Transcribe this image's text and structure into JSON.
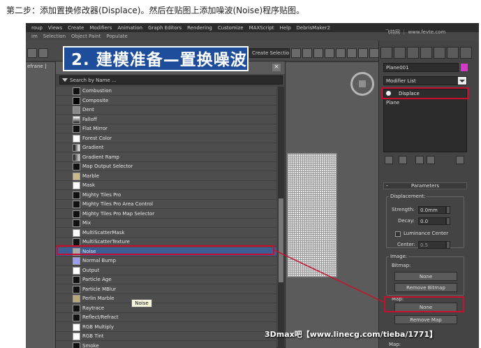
{
  "caption": "第二步：添加置换修改器(Displace)。然后在贴图上添加噪波(Noise)程序贴图。",
  "menubar": [
    "roup",
    "Views",
    "Create",
    "Modifiers",
    "Animation",
    "Graph Editors",
    "Rendering",
    "Customize",
    "MAXScript",
    "Help",
    "DebrisMaker2"
  ],
  "toolbar1": [
    "im",
    "Selection",
    "Object Paint",
    "Populate"
  ],
  "selection_set_label": "Create Selection Se",
  "viewport_label": "efrane ]",
  "badge_text": "2. 建模准备—置换噪波",
  "material_browser": {
    "search_placeholder": "Search by Name ...",
    "items": [
      "Combustion",
      "Composite",
      "Dent",
      "Falloff",
      "Flat Mirror",
      "Forest Color",
      "Gradient",
      "Gradient Ramp",
      "Map Output Selector",
      "Marble",
      "Mask",
      "Mighty Tiles Pro",
      "Mighty Tiles Pro Area Control",
      "Mighty Tiles Pro Map Selector",
      "Mix",
      "MultiScatterMask",
      "MultiScatterTexture",
      "Noise",
      "Normal Bump",
      "Output",
      "Particle Age",
      "Particle MBlur",
      "Perlin Marble",
      "Raytrace",
      "Reflect/Refract",
      "RGB Multiply",
      "RGB Tint",
      "Smoke"
    ],
    "selected_item": "Noise",
    "tooltip": "Noise"
  },
  "watermark_top": "飞特网 ｜ www.fevte.com",
  "command_panel": {
    "object_name": "Plane001",
    "object_color": "#d23cc2",
    "modifier_list_label": "Modifier List",
    "stack": [
      "Displace",
      "Plane"
    ],
    "parameters": {
      "title": "Parameters",
      "displacement_label": "Displacement:",
      "strength_label": "Strength:",
      "strength_value": "0.0mm",
      "decay_label": "Decay:",
      "decay_value": "0.0",
      "luminance_center_label": "Luminance Center",
      "center_label": "Center:",
      "center_value": "0.5",
      "image_label": "Image:",
      "bitmap_label": "Bitmap:",
      "bitmap_button": "None",
      "remove_bitmap_button": "Remove Bitmap",
      "map_label": "Map:",
      "map_button": "None",
      "remove_map_button": "Remove Map",
      "map_label_2": "Map:"
    }
  },
  "footer_watermark": "3Dmax吧【www.linecg.com/tieba/1771】",
  "colors": {
    "highlight_red": "#c8102e",
    "badge_blue": "#1d4d9b",
    "selection_blue": "#3c5e92"
  }
}
